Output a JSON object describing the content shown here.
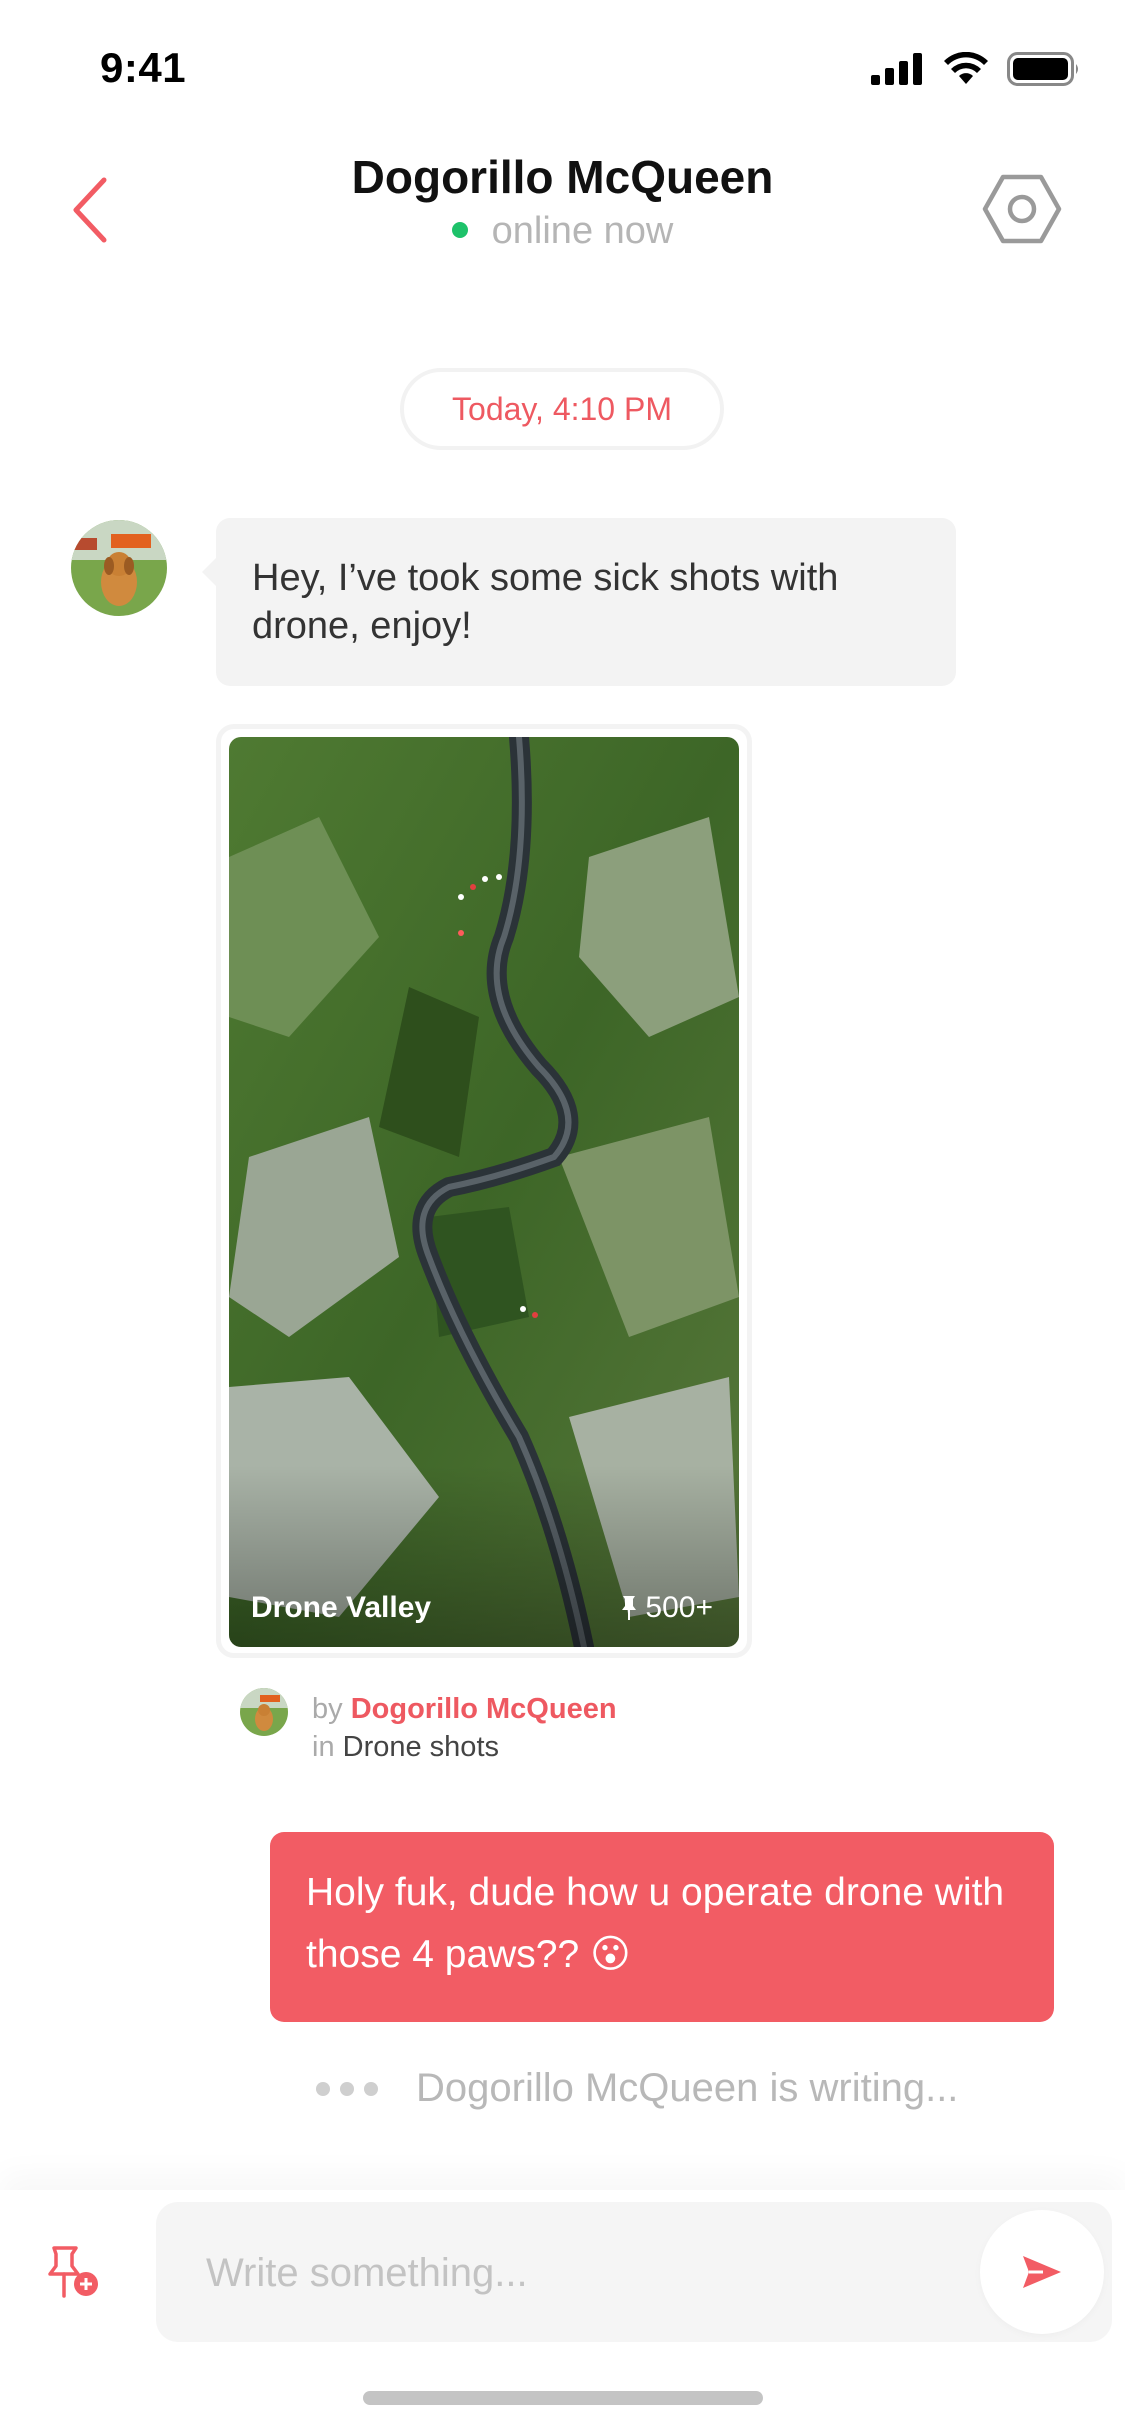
{
  "status_bar": {
    "time": "9:41"
  },
  "header": {
    "title": "Dogorillo McQueen",
    "presence": "online now",
    "presence_color": "#1ec26a"
  },
  "date_separator": "Today, 4:10 PM",
  "messages": {
    "incoming_text": "Hey, I’ve took some sick shots with drone, enjoy!",
    "shared_photo": {
      "caption": "Drone Valley",
      "pin_icon": "pin-icon",
      "pin_count": "500+",
      "by_prefix": "by",
      "author": "Dogorillo McQueen",
      "in_prefix": "in",
      "collection": "Drone shots"
    },
    "outgoing_text": "Holy fuk, dude how u operate drone with those 4 paws?? 😮",
    "typing_indicator": "Dogorillo McQueen is writing..."
  },
  "composer": {
    "placeholder": "Write something...",
    "attach_icon": "pin-add-icon",
    "send_icon": "send-icon"
  },
  "colors": {
    "accent": "#f25c64",
    "incoming_bubble": "#f3f3f3"
  }
}
